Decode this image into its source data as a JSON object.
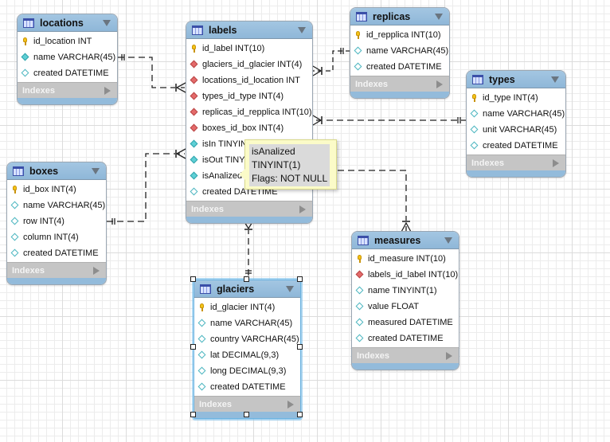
{
  "diagram": {
    "tables": {
      "locations": {
        "name": "locations",
        "columns": [
          {
            "text": "id_location INT",
            "kind": "primary-key"
          },
          {
            "text": "name VARCHAR(45)",
            "kind": "not-null"
          },
          {
            "text": "created DATETIME",
            "kind": "column"
          }
        ],
        "indexes_label": "Indexes"
      },
      "labels": {
        "name": "labels",
        "columns": [
          {
            "text": "id_label INT(10)",
            "kind": "primary-key"
          },
          {
            "text": "glaciers_id_glacier INT(4)",
            "kind": "foreign-key"
          },
          {
            "text": "locations_id_location INT",
            "kind": "foreign-key"
          },
          {
            "text": "types_id_type INT(4)",
            "kind": "foreign-key"
          },
          {
            "text": "replicas_id_repplica INT(10)",
            "kind": "foreign-key"
          },
          {
            "text": "boxes_id_box INT(4)",
            "kind": "foreign-key"
          },
          {
            "text": "isIn TINYINT(1)",
            "kind": "not-null"
          },
          {
            "text": "isOut TINYINT(1)",
            "kind": "not-null"
          },
          {
            "text": "isAnalized TINYINT(1)",
            "kind": "not-null"
          },
          {
            "text": "created DATETIME",
            "kind": "column"
          }
        ],
        "indexes_label": "Indexes"
      },
      "replicas": {
        "name": "replicas",
        "columns": [
          {
            "text": "id_repplica INT(10)",
            "kind": "primary-key"
          },
          {
            "text": "name VARCHAR(45)",
            "kind": "column"
          },
          {
            "text": "created DATETIME",
            "kind": "column"
          }
        ],
        "indexes_label": "Indexes"
      },
      "types": {
        "name": "types",
        "columns": [
          {
            "text": "id_type INT(4)",
            "kind": "primary-key"
          },
          {
            "text": "name VARCHAR(45)",
            "kind": "column"
          },
          {
            "text": "unit VARCHAR(45)",
            "kind": "column"
          },
          {
            "text": "created DATETIME",
            "kind": "column"
          }
        ],
        "indexes_label": "Indexes"
      },
      "boxes": {
        "name": "boxes",
        "columns": [
          {
            "text": "id_box INT(4)",
            "kind": "primary-key"
          },
          {
            "text": "name VARCHAR(45)",
            "kind": "column"
          },
          {
            "text": "row INT(4)",
            "kind": "column"
          },
          {
            "text": "column INT(4)",
            "kind": "column"
          },
          {
            "text": "created DATETIME",
            "kind": "column"
          }
        ],
        "indexes_label": "Indexes"
      },
      "measures": {
        "name": "measures",
        "columns": [
          {
            "text": "id_measure INT(10)",
            "kind": "primary-key"
          },
          {
            "text": "labels_id_label INT(10)",
            "kind": "foreign-key"
          },
          {
            "text": "name TINYINT(1)",
            "kind": "column"
          },
          {
            "text": "value FLOAT",
            "kind": "column"
          },
          {
            "text": "measured DATETIME",
            "kind": "column"
          },
          {
            "text": "created DATETIME",
            "kind": "column"
          }
        ],
        "indexes_label": "Indexes"
      },
      "glaciers": {
        "name": "glaciers",
        "selected": true,
        "columns": [
          {
            "text": "id_glacier INT(4)",
            "kind": "primary-key"
          },
          {
            "text": "name VARCHAR(45)",
            "kind": "column"
          },
          {
            "text": "country VARCHAR(45)",
            "kind": "column"
          },
          {
            "text": "lat DECIMAL(9,3)",
            "kind": "column"
          },
          {
            "text": "long DECIMAL(9,3)",
            "kind": "column"
          },
          {
            "text": "created DATETIME",
            "kind": "column"
          }
        ],
        "indexes_label": "Indexes"
      }
    },
    "relationships": [
      {
        "from": "locations",
        "to": "labels",
        "from_cardinality": "one",
        "to_cardinality": "many"
      },
      {
        "from": "boxes",
        "to": "labels",
        "from_cardinality": "one",
        "to_cardinality": "many"
      },
      {
        "from": "replicas",
        "to": "labels",
        "from_cardinality": "one",
        "to_cardinality": "many"
      },
      {
        "from": "types",
        "to": "labels",
        "from_cardinality": "one",
        "to_cardinality": "many"
      },
      {
        "from": "labels",
        "to": "measures",
        "from_cardinality": "one",
        "to_cardinality": "many"
      },
      {
        "from": "glaciers",
        "to": "labels",
        "from_cardinality": "one",
        "to_cardinality": "many"
      }
    ],
    "tooltip": {
      "lines": [
        "isAnalized",
        "TINYINT(1)",
        "Flags: NOT NULL"
      ]
    },
    "colors": {
      "header": "#8fb7d8",
      "indexes_bar": "#c5c5c5",
      "tooltip_bg": "#fbfbc8",
      "foreign_key": "#e46a6a",
      "not_null": "#5fd0d6",
      "primary_key": "#f3c316"
    }
  }
}
